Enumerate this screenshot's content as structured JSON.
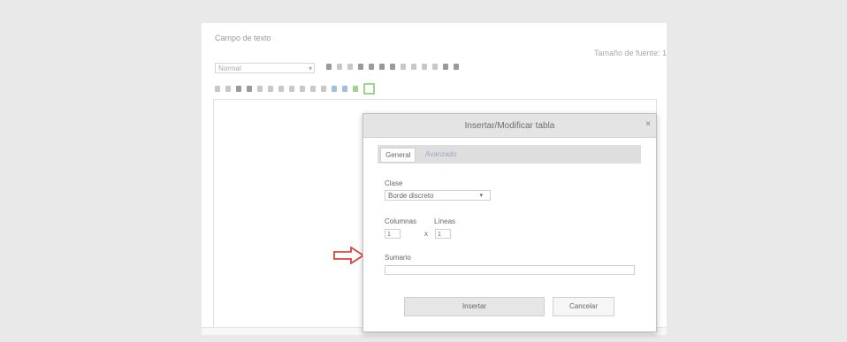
{
  "editor": {
    "title": "Campo de texto",
    "font_size_label": "Tamaño de fuente: 1",
    "format_select": "Normal"
  },
  "dialog": {
    "title": "Insertar/Modificar tabla",
    "close": "×",
    "tabs": [
      {
        "label": "General",
        "active": true
      },
      {
        "label": "Avanzado",
        "active": false
      }
    ],
    "class_label": "Clase",
    "class_value": "Borde discreto",
    "columns_label": "Columnas",
    "rows_label": "Líneas",
    "columns_value": "1",
    "times": "x",
    "rows_value": "1",
    "summary_label": "Sumario",
    "summary_value": "",
    "insert_button": "Insertar",
    "cancel_button": "Cancelar"
  },
  "colors": {
    "arrow": "#d9443a",
    "accent_green": "#9fd48e"
  },
  "icons": [
    "close-icon",
    "chevron-down-icon",
    "arrow-right-icon"
  ]
}
